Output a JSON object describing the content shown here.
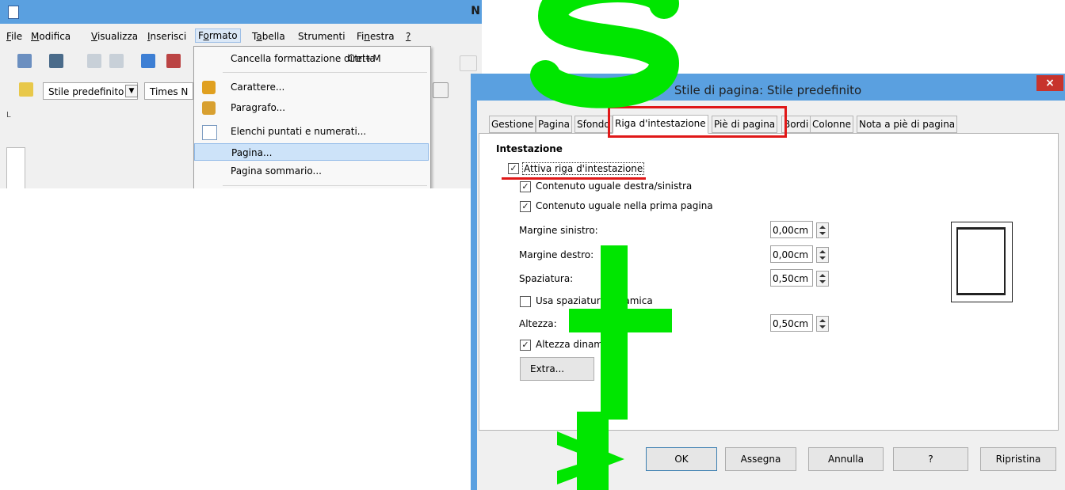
{
  "writer": {
    "title_fragment": "N",
    "menu": [
      {
        "label": "File",
        "u": "F",
        "rest": "ile"
      },
      {
        "label": "Modifica",
        "u": "M",
        "rest": "odifica"
      },
      {
        "label": "Visualizza",
        "u": "V",
        "rest": "isualizza"
      },
      {
        "label": "Inserisci",
        "u": "I",
        "rest": "nserisci"
      },
      {
        "label": "Formato",
        "pre": "F",
        "u": "o",
        "rest": "rmato"
      },
      {
        "label": "Tabella",
        "pre": "T",
        "u": "a",
        "rest": "bella"
      },
      {
        "label": "Strumenti",
        "pre": "",
        "u": "",
        "rest": "Strumenti"
      },
      {
        "label": "Finestra",
        "pre": "Fi",
        "u": "n",
        "rest": "estra"
      },
      {
        "label": "?",
        "u": "?",
        "rest": ""
      }
    ],
    "style_box": "Stile predefinito",
    "font_box": "Times N",
    "ruler_marker": "L"
  },
  "format_menu": {
    "items": [
      {
        "label": "Cancella formattazione diretta",
        "shortcut": "Ctrl+M"
      },
      {
        "label": "Carattere..."
      },
      {
        "label": "Paragrafo..."
      },
      {
        "label": "Elenchi puntati e numerati..."
      },
      {
        "label": "Pagina..."
      },
      {
        "label": "Pagina sommario..."
      }
    ]
  },
  "dialog": {
    "title": "Stile di pagina: Stile predefinito",
    "close": "×",
    "tabs": [
      "Gestione",
      "Pagina",
      "Sfondo",
      "Riga d'intestazione",
      "Piè di pagina",
      "Bordi",
      "Colonne",
      "Nota a piè di pagina"
    ],
    "section_title": "Intestazione",
    "activate_header": "Attiva riga d'intestazione",
    "same_content_lr": "Contenuto uguale destra/sinistra",
    "same_content_first": "Contenuto uguale nella prima pagina",
    "left_margin_label": "Margine sinistro:",
    "left_margin_value": "0,00cm",
    "right_margin_label": "Margine destro:",
    "right_margin_value": "0,00cm",
    "spacing_label": "Spaziatura:",
    "spacing_value": "0,50cm",
    "dynamic_spacing": "Usa spaziatura dinamica",
    "height_label": "Altezza:",
    "height_value": "0,50cm",
    "dynamic_height": "Altezza dinamica",
    "extra_button": "Extra...",
    "buttons": {
      "ok": "OK",
      "apply": "Assegna",
      "cancel": "Annulla",
      "help": "?",
      "reset": "Ripristina"
    },
    "checks": {
      "activate": true,
      "same_lr": true,
      "same_first": true,
      "dynamic_spacing": false,
      "dynamic_height": true
    }
  },
  "colors": {
    "highlight_red": "#e01818",
    "watermark_green": "#00e600",
    "title_blue": "#5aa0e0"
  }
}
